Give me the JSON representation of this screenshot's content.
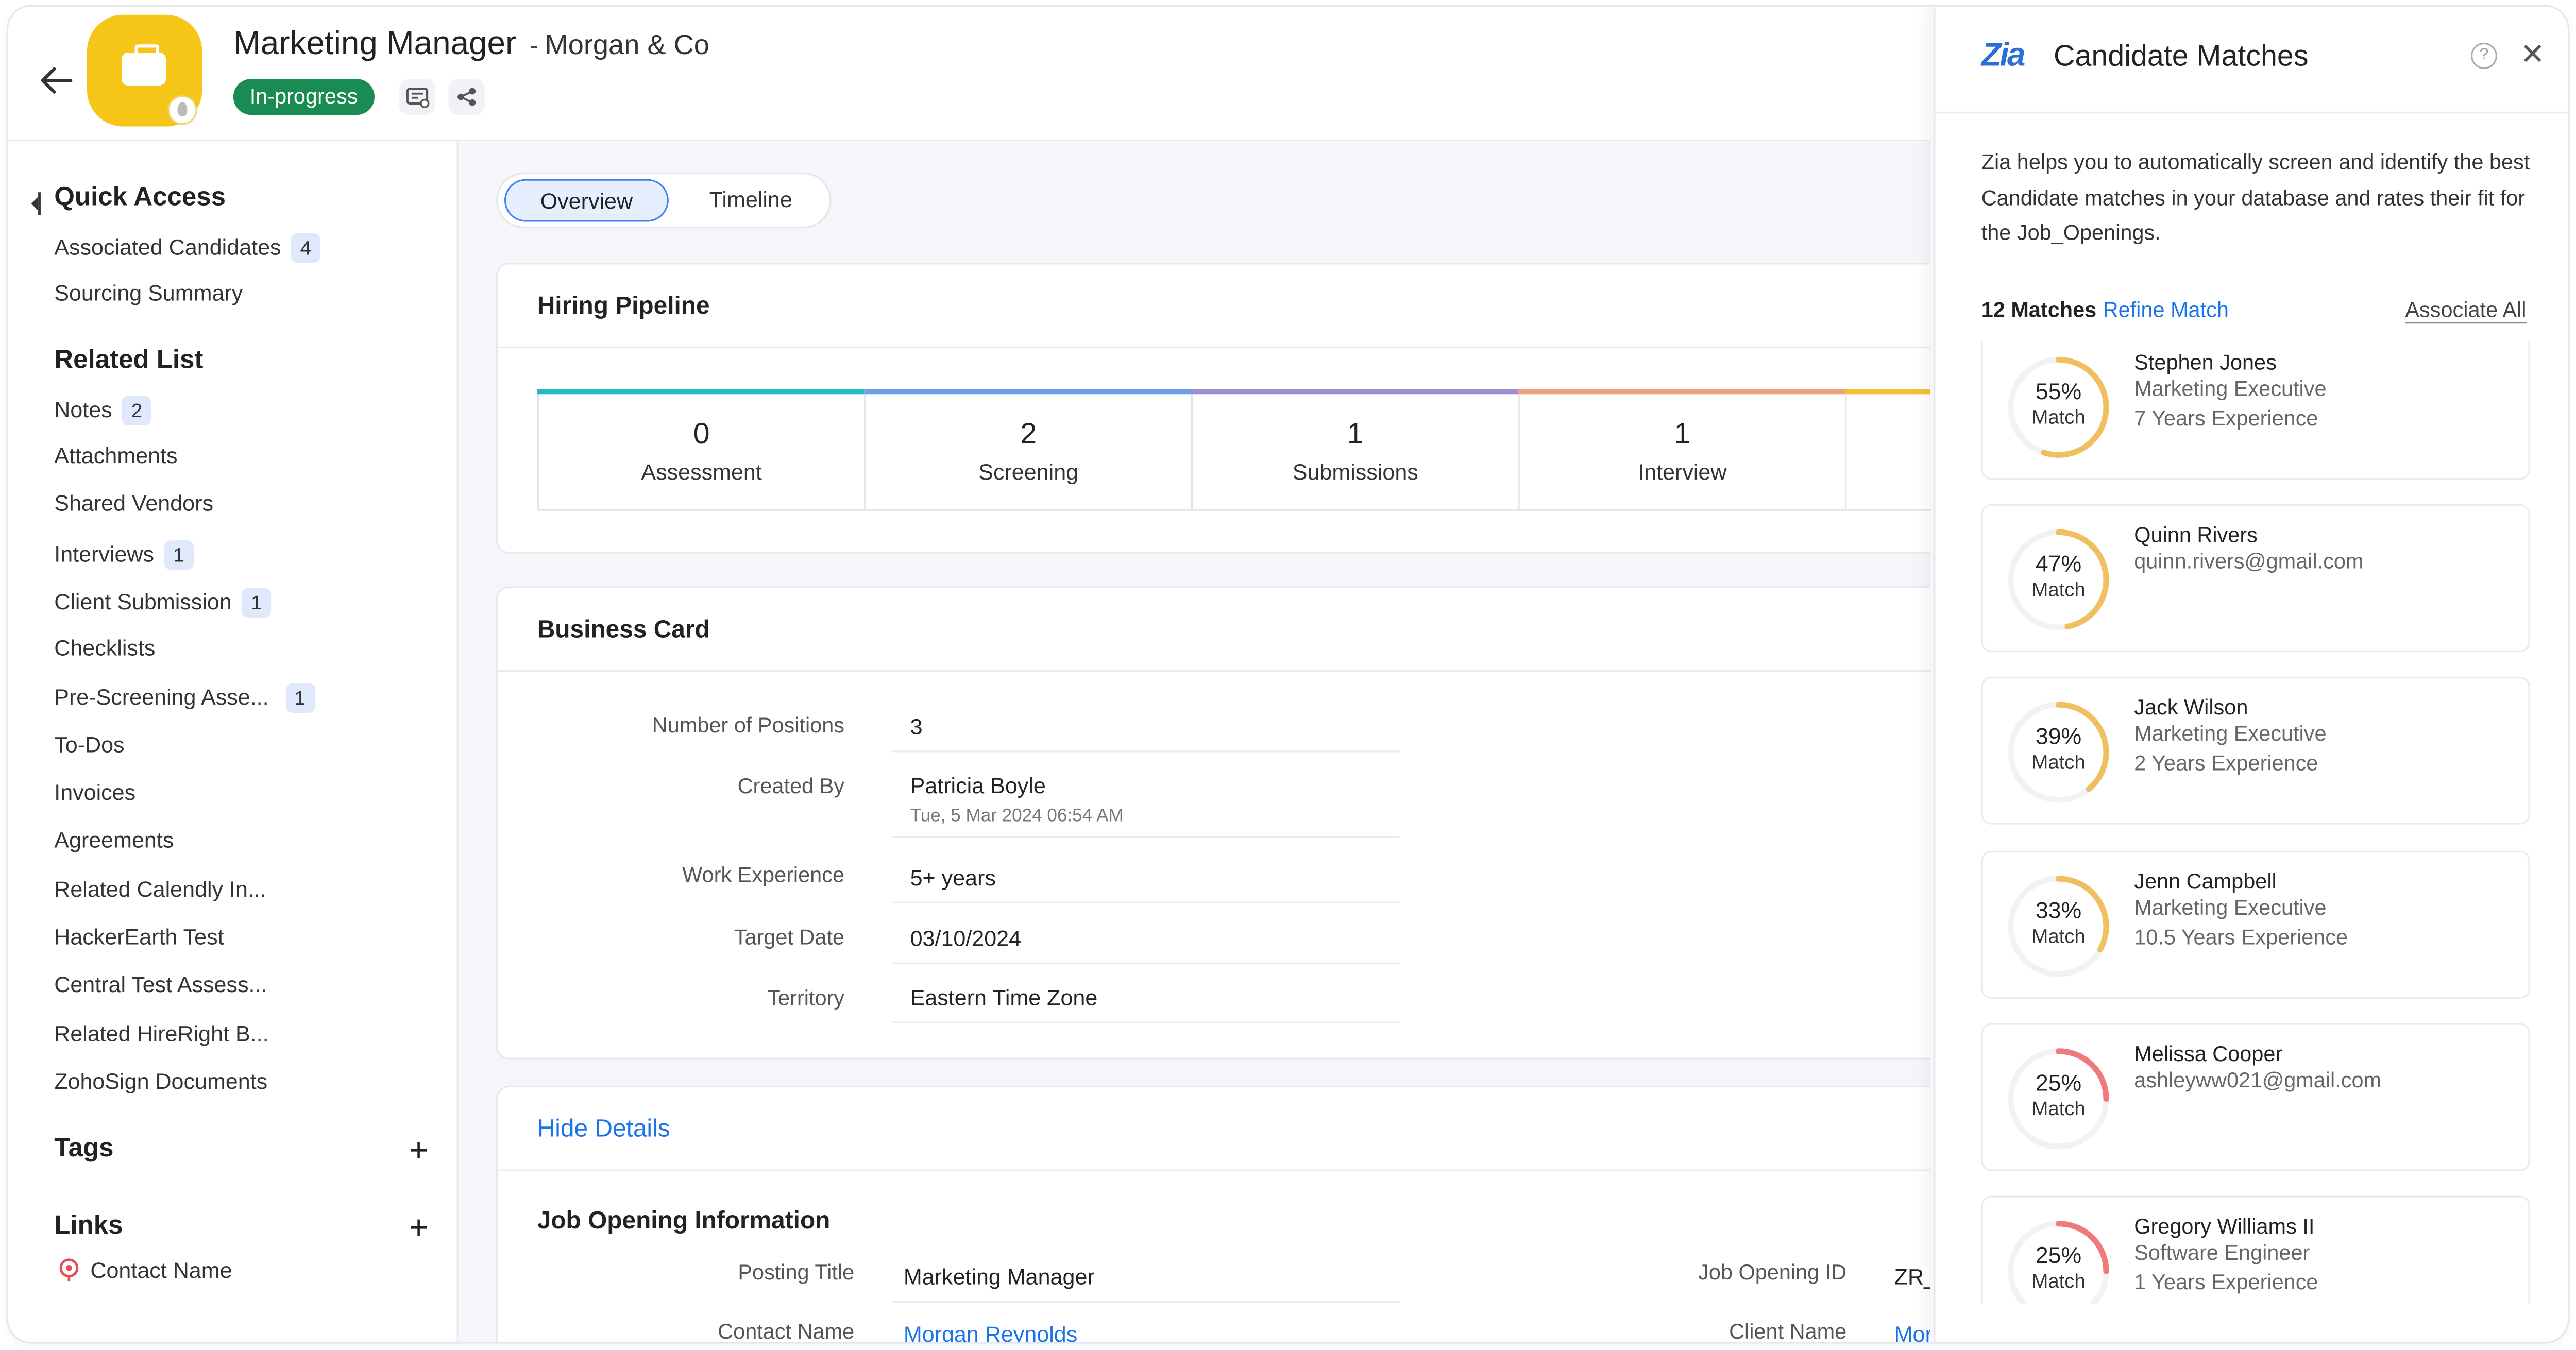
{
  "header": {
    "title": "Marketing Manager",
    "separator": "-",
    "company": "Morgan & Co",
    "status": "In-progress",
    "status_color": "#1b8b54"
  },
  "sidebar": {
    "quick_access": {
      "title": "Quick Access",
      "items": [
        {
          "label": "Associated Candidates",
          "count": "4"
        },
        {
          "label": "Sourcing Summary",
          "count": ""
        }
      ]
    },
    "related_list": {
      "title": "Related List",
      "items": [
        {
          "label": "Notes",
          "count": "2"
        },
        {
          "label": "Attachments",
          "count": ""
        },
        {
          "label": "Shared Vendors",
          "count": ""
        },
        {
          "label": "Interviews",
          "count": "1"
        },
        {
          "label": "Client Submission",
          "count": "1"
        },
        {
          "label": "Checklists",
          "count": ""
        },
        {
          "label": "Pre-Screening Asse...",
          "count": "1"
        },
        {
          "label": "To-Dos",
          "count": ""
        },
        {
          "label": "Invoices",
          "count": ""
        },
        {
          "label": "Agreements",
          "count": ""
        },
        {
          "label": "Related Calendly In...",
          "count": ""
        },
        {
          "label": "HackerEarth Test",
          "count": ""
        },
        {
          "label": "Central Test Assess...",
          "count": ""
        },
        {
          "label": "Related HireRight B...",
          "count": ""
        },
        {
          "label": "ZohoSign Documents",
          "count": ""
        }
      ]
    },
    "tags": {
      "title": "Tags"
    },
    "links": {
      "title": "Links",
      "contact": "Contact Name"
    }
  },
  "tabs": [
    "Overview",
    "Timeline"
  ],
  "pipeline": {
    "title": "Hiring Pipeline",
    "stages": [
      {
        "count": "0",
        "label": "Assessment",
        "color": "#22b8c8"
      },
      {
        "count": "2",
        "label": "Screening",
        "color": "#6ea0e8"
      },
      {
        "count": "1",
        "label": "Submissions",
        "color": "#9b8fd8"
      },
      {
        "count": "1",
        "label": "Interview",
        "color": "#f0a07a"
      },
      {
        "count": "",
        "label": "",
        "color": "#f2c230"
      }
    ]
  },
  "business_card": {
    "title": "Business Card",
    "fields": [
      {
        "label": "Number of Positions",
        "value": "3"
      },
      {
        "label": "Created By",
        "value": "Patricia Boyle",
        "sub": "Tue, 5 Mar 2024 06:54 AM"
      },
      {
        "label": "Work Experience",
        "value": "5+ years"
      },
      {
        "label": "Target Date",
        "value": "03/10/2024"
      },
      {
        "label": "Territory",
        "value": "Eastern Time Zone"
      }
    ]
  },
  "details": {
    "hide_label": "Hide Details",
    "section_title": "Job Opening Information",
    "left": [
      {
        "label": "Posting Title",
        "value": "Marketing Manager"
      },
      {
        "label": "Contact Name",
        "value": "Morgan Reynolds"
      }
    ],
    "right": [
      {
        "label": "Job Opening ID",
        "value": "ZR_"
      },
      {
        "label": "Client Name",
        "value": "Mor"
      }
    ]
  },
  "panel": {
    "logo": "Zia",
    "title": "Candidate Matches",
    "help": "?",
    "description": "Zia helps you to automatically screen and identify the best Candidate matches in your database and rates their fit for the Job_Openings.",
    "match_count": "12 Matches",
    "refine": "Refine Match",
    "associate_all": "Associate All",
    "match_label": "Match",
    "matches": [
      {
        "percent": 55,
        "percent_text": "55%",
        "name": "Stephen Jones",
        "line1": "Marketing Executive",
        "line2": "7 Years Experience",
        "color": "#f0c060"
      },
      {
        "percent": 47,
        "percent_text": "47%",
        "name": "Quinn Rivers",
        "line1": "quinn.rivers@gmail.com",
        "line2": "",
        "color": "#f0c060"
      },
      {
        "percent": 39,
        "percent_text": "39%",
        "name": "Jack Wilson",
        "line1": "Marketing Executive",
        "line2": "2 Years Experience",
        "color": "#f0c060"
      },
      {
        "percent": 33,
        "percent_text": "33%",
        "name": "Jenn Campbell",
        "line1": "Marketing Executive",
        "line2": "10.5 Years Experience",
        "color": "#f0c060"
      },
      {
        "percent": 25,
        "percent_text": "25%",
        "name": "Melissa Cooper",
        "line1": "ashleyww021@gmail.com",
        "line2": "",
        "color": "#f07a7a"
      },
      {
        "percent": 25,
        "percent_text": "25%",
        "name": "Gregory Williams II",
        "line1": "Software Engineer",
        "line2": "1 Years Experience",
        "color": "#f07a7a"
      }
    ]
  }
}
